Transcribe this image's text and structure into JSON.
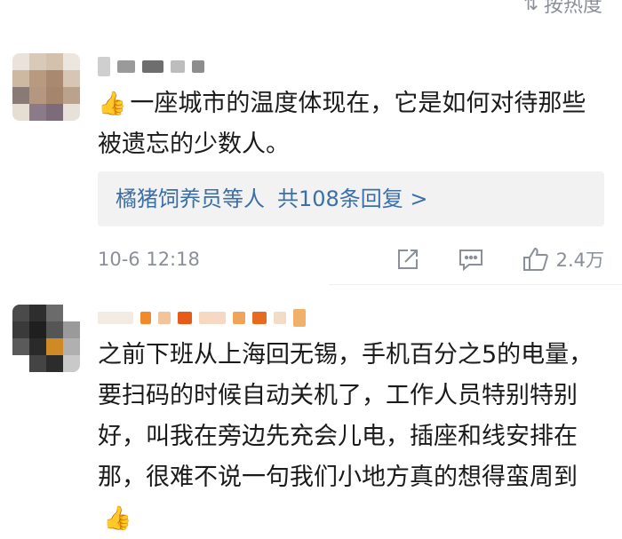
{
  "sort": {
    "label": "按热度",
    "icon": "sort-icon"
  },
  "comments": [
    {
      "text": "一座城市的温度体现在，它是如何对待那些被遗忘的少数人。",
      "emoji": "thumbs-up-emoji",
      "replies": {
        "users": "橘猪饲养员等人",
        "count": "共108条回复 >"
      },
      "time": "10-6 12:18",
      "likes": "2.4万"
    },
    {
      "text": "之前下班从上海回无锡，手机百分之5的电量，要扫码的时候自动关机了，工作人员特别特别好，叫我在旁边先充会儿电，插座和线安排在那，很难不说一句我们小地方真的想得蛮周到",
      "emoji": "thumbs-up-emoji"
    }
  ],
  "colors": {
    "link": "#3b6fa8",
    "meta": "#8a8f99",
    "reply_bg": "#f2f2f2"
  }
}
